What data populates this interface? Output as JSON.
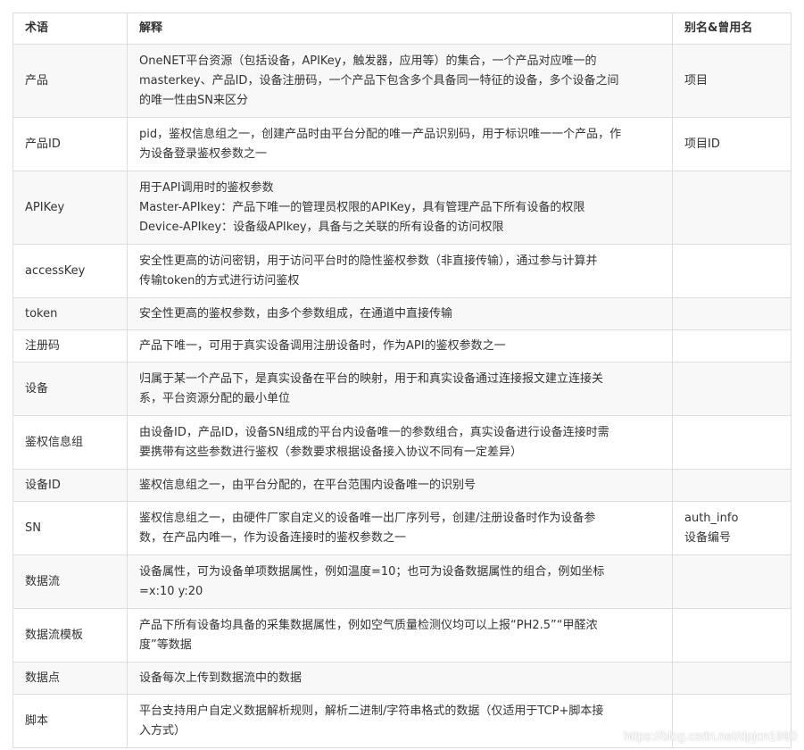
{
  "headers": {
    "term": "术语",
    "desc": "解释",
    "alias": "别名&曾用名"
  },
  "rows": [
    {
      "term": "产品",
      "desc": [
        "OneNET平台资源（包括设备，APIKey，触发器，应用等）的集合，一个产品对应唯一的",
        "masterkey、产品ID，设备注册码，一个产品下包含多个具备同一特征的设备，多个设备之间",
        "的唯一性由SN来区分"
      ],
      "alias": [
        "项目"
      ]
    },
    {
      "term": "产品ID",
      "desc": [
        "pid，鉴权信息组之一，创建产品时由平台分配的唯一产品识别码，用于标识唯一一个产品，作",
        "为设备登录鉴权参数之一"
      ],
      "alias": [
        "项目ID"
      ]
    },
    {
      "term": "APIKey",
      "desc": [
        "用于API调用时的鉴权参数",
        "Master-APIkey：产品下唯一的管理员权限的APIKey，具有管理产品下所有设备的权限",
        "Device-APIkey：设备级APIkey，具备与之关联的所有设备的访问权限"
      ],
      "alias": []
    },
    {
      "term": "accessKey",
      "desc": [
        "安全性更高的访问密钥，用于访问平台时的隐性鉴权参数（非直接传输），通过参与计算并",
        "传输token的方式进行访问鉴权"
      ],
      "alias": []
    },
    {
      "term": "token",
      "desc": [
        "安全性更高的鉴权参数，由多个参数组成，在通道中直接传输"
      ],
      "alias": []
    },
    {
      "term": "注册码",
      "desc": [
        "产品下唯一，可用于真实设备调用注册设备时，作为API的鉴权参数之一"
      ],
      "alias": []
    },
    {
      "term": "设备",
      "desc": [
        "归属于某一个产品下，是真实设备在平台的映射，用于和真实设备通过连接报文建立连接关",
        "系，平台资源分配的最小单位"
      ],
      "alias": []
    },
    {
      "term": "鉴权信息组",
      "desc": [
        "由设备ID，产品ID，设备SN组成的平台内设备唯一的参数组合，真实设备进行设备连接时需",
        "要携带有这些参数进行鉴权（参数要求根据设备接入协议不同有一定差异）"
      ],
      "alias": []
    },
    {
      "term": "设备ID",
      "desc": [
        "鉴权信息组之一，由平台分配的，在平台范围内设备唯一的识别号"
      ],
      "alias": []
    },
    {
      "term": "SN",
      "desc": [
        "鉴权信息组之一，由硬件厂家自定义的设备唯一出厂序列号，创建/注册设备时作为设备参",
        "数，在产品内唯一，作为设备连接时的鉴权参数之一"
      ],
      "alias": [
        "auth_info",
        "设备编号"
      ]
    },
    {
      "term": "数据流",
      "desc": [
        "设备属性，可为设备单项数据属性，例如温度=10；也可为设备数据属性的组合，例如坐标",
        "=x:10 y:20"
      ],
      "alias": []
    },
    {
      "term": "数据流模板",
      "desc": [
        "产品下所有设备均具备的采集数据属性，例如空气质量检测仪均可以上报“PH2.5”“甲醛浓",
        "度”等数据"
      ],
      "alias": []
    },
    {
      "term": "数据点",
      "desc": [
        "设备每次上传到数据流中的数据"
      ],
      "alias": []
    },
    {
      "term": "脚本",
      "desc": [
        "平台支持用户自定义数据解析规则，解析二进制/字符串格式的数据（仅适用于TCP+脚本接",
        "入方式）"
      ],
      "alias": []
    }
  ],
  "watermark": "https://blog.csdn.net/dpjcn1990"
}
